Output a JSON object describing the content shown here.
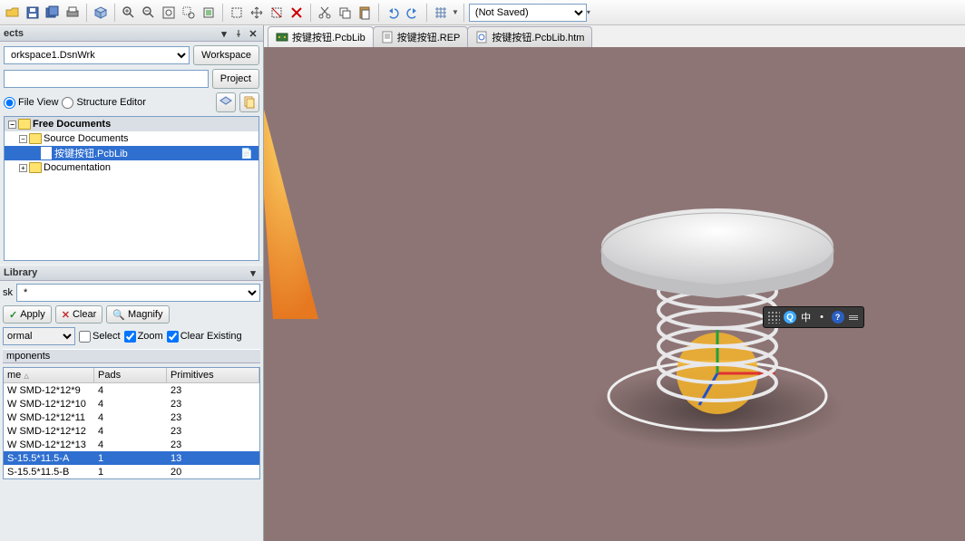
{
  "toolbar": {
    "dropdown_value": "(Not Saved)"
  },
  "projects": {
    "panel_title": "ects",
    "workspace_value": "orkspace1.DsnWrk",
    "workspace_btn": "Workspace",
    "project_btn": "Project",
    "file_view": "File View",
    "structure_editor": "Structure Editor",
    "tree": {
      "free_docs": "Free Documents",
      "source_docs": "Source Documents",
      "selected_file": "按键按钮.PcbLib",
      "documentation": "Documentation"
    }
  },
  "library": {
    "panel_title": "Library",
    "mask_label": "sk",
    "mask_value": "*",
    "apply": "Apply",
    "clear": "Clear",
    "magnify": "Magnify",
    "mode": "ormal",
    "select": "Select",
    "zoom": "Zoom",
    "clear_existing": "Clear Existing",
    "components_label": "mponents",
    "cols": {
      "name": "me",
      "pads": "Pads",
      "prims": "Primitives"
    },
    "rows": [
      {
        "name": "W SMD-12*12*9",
        "pads": "4",
        "prims": "23"
      },
      {
        "name": "W SMD-12*12*10",
        "pads": "4",
        "prims": "23"
      },
      {
        "name": "W SMD-12*12*11",
        "pads": "4",
        "prims": "23"
      },
      {
        "name": "W SMD-12*12*12",
        "pads": "4",
        "prims": "23"
      },
      {
        "name": "W SMD-12*12*13",
        "pads": "4",
        "prims": "23"
      },
      {
        "name": "S-15.5*11.5-A",
        "pads": "1",
        "prims": "13",
        "selected": true
      },
      {
        "name": "S-15.5*11.5-B",
        "pads": "1",
        "prims": "20"
      }
    ]
  },
  "tabs": [
    {
      "label": "按键按钮.PcbLib",
      "icon": "pcb"
    },
    {
      "label": "按键按钮.REP",
      "icon": "txt"
    },
    {
      "label": "按键按钮.PcbLib.htm",
      "icon": "htm"
    }
  ],
  "ime": {
    "mode": "中"
  }
}
